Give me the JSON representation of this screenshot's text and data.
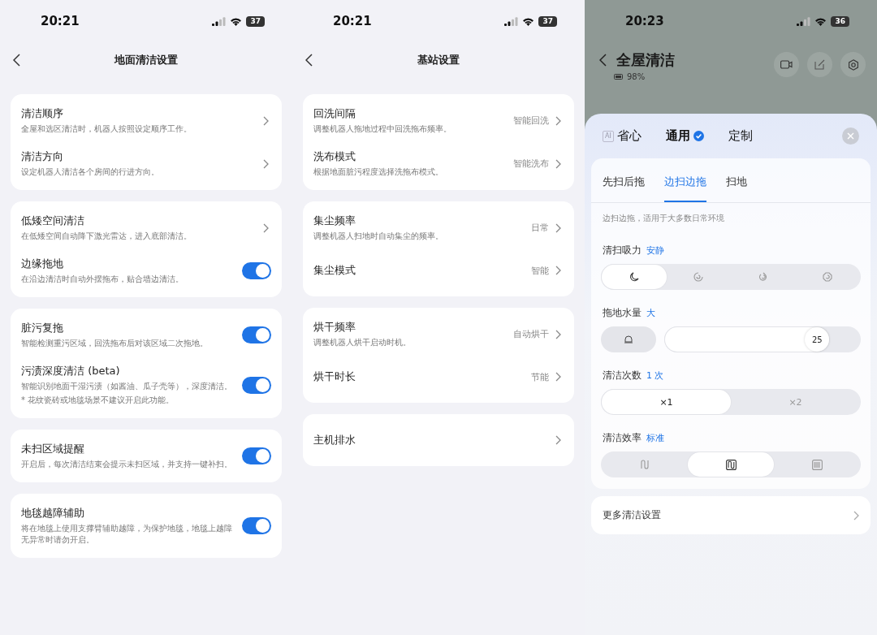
{
  "screens": [
    {
      "kind": "settings",
      "status": {
        "time": "20:21",
        "battery": "37"
      },
      "title": "地面清洁设置",
      "groups": [
        {
          "rows": [
            {
              "kind": "link",
              "title": "清洁顺序",
              "desc": "全屋和选区清洁时，机器人按照设定顺序工作。"
            },
            {
              "kind": "link",
              "title": "清洁方向",
              "desc": "设定机器人清洁各个房间的行进方向。"
            }
          ]
        },
        {
          "rows": [
            {
              "kind": "link",
              "title": "低矮空间清洁",
              "desc": "在低矮空间自动降下激光雷达，进入底部清洁。"
            },
            {
              "kind": "toggle",
              "title": "边缘拖地",
              "desc": "在沿边清洁时自动外摆拖布，贴合墙边清洁。",
              "on": true
            }
          ]
        },
        {
          "rows": [
            {
              "kind": "toggle",
              "title": "脏污复拖",
              "desc": "智能检测重污区域，回洗拖布后对该区域二次拖地。",
              "on": true
            },
            {
              "kind": "toggle",
              "title": "污渍深度清洁 (beta)",
              "desc": "智能识别地面干湿污渍（如酱油、瓜子壳等），深度清洁。",
              "note": "* 花纹瓷砖或地毯场景不建议开启此功能。",
              "on": true
            }
          ]
        },
        {
          "rows": [
            {
              "kind": "toggle",
              "title": "未扫区域提醒",
              "desc": "开启后，每次清洁结束会提示未扫区域，并支持一键补扫。",
              "on": true
            }
          ]
        },
        {
          "rows": [
            {
              "kind": "toggle",
              "title": "地毯越障辅助",
              "desc": "将在地毯上使用支撑臂辅助越障，为保护地毯，地毯上越障无异常时请勿开启。",
              "on": true
            }
          ]
        }
      ]
    },
    {
      "kind": "settings",
      "status": {
        "time": "20:21",
        "battery": "37"
      },
      "title": "基站设置",
      "groups": [
        {
          "rows": [
            {
              "kind": "link",
              "title": "回洗间隔",
              "desc": "调整机器人拖地过程中回洗拖布频率。",
              "value": "智能回洗"
            },
            {
              "kind": "link",
              "title": "洗布模式",
              "desc": "根据地面脏污程度选择洗拖布模式。",
              "value": "智能洗布"
            }
          ]
        },
        {
          "rows": [
            {
              "kind": "link",
              "title": "集尘频率",
              "desc": "调整机器人扫地时自动集尘的频率。",
              "value": "日常"
            },
            {
              "kind": "link",
              "title": "集尘模式",
              "value": "智能"
            }
          ]
        },
        {
          "rows": [
            {
              "kind": "link",
              "title": "烘干频率",
              "desc": "调整机器人烘干启动时机。",
              "value": "自动烘干"
            },
            {
              "kind": "link",
              "title": "烘干时长",
              "value": "节能"
            }
          ]
        },
        {
          "rows": [
            {
              "kind": "link",
              "title": "主机排水"
            }
          ]
        }
      ]
    },
    {
      "kind": "sheet",
      "status": {
        "time": "20:23",
        "battery": "36"
      },
      "title": "全屋清洁",
      "robot_battery": "98%",
      "modes": [
        {
          "label": "省心",
          "badge": "AI",
          "selected": false
        },
        {
          "label": "通用",
          "selected": true
        },
        {
          "label": "定制",
          "selected": false
        }
      ],
      "tabs": [
        {
          "label": "先扫后拖",
          "selected": false
        },
        {
          "label": "边扫边拖",
          "selected": true
        },
        {
          "label": "扫地",
          "selected": false
        }
      ],
      "tab_desc": "边扫边拖，适用于大多数日常环境",
      "sections": [
        {
          "kind": "segments",
          "label": "清扫吸力",
          "value": "安静",
          "options": [
            {
              "kind": "moon",
              "selected": true
            },
            {
              "kind": "swirl",
              "selected": false
            },
            {
              "kind": "swirl2",
              "selected": false
            },
            {
              "kind": "swirl3",
              "selected": false
            }
          ]
        },
        {
          "kind": "slider",
          "label": "拖地水量",
          "value": "大",
          "level": 0.84,
          "reading": "25"
        },
        {
          "kind": "segments",
          "label": "清洁次数",
          "value": "1 次",
          "options": [
            {
              "text": "×1",
              "selected": true
            },
            {
              "text": "×2",
              "selected": false
            }
          ]
        },
        {
          "kind": "segments",
          "label": "清洁效率",
          "value": "标准",
          "options": [
            {
              "kind": "sparse",
              "selected": false
            },
            {
              "kind": "standard",
              "selected": true
            },
            {
              "kind": "dense",
              "selected": false
            }
          ]
        }
      ],
      "more": "更多清洁设置"
    }
  ]
}
